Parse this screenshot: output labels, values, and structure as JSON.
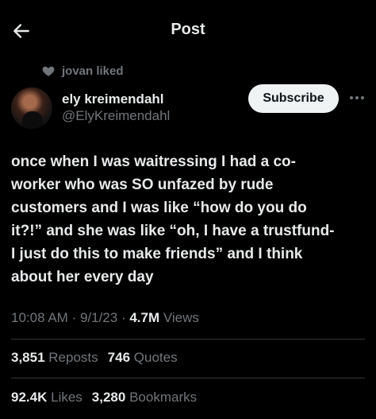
{
  "header": {
    "title": "Post"
  },
  "social_context": {
    "text": "jovan liked"
  },
  "author": {
    "name": "ely kreimendahl",
    "handle": "@ElyKreimendahl"
  },
  "actions": {
    "subscribe_label": "Subscribe"
  },
  "tweet": {
    "text": "once when I was waitressing I had a co-\nworker who was SO unfazed by rude\ncustomers and I was like “how do you do\nit?!” and she was like “oh, I have a trustfund-\nI just do this to make friends” and I think\nabout her every day",
    "time": "10:08 AM",
    "date": "9/1/23",
    "views_count": "4.7M",
    "views_label": "Views"
  },
  "stats": {
    "reposts_count": "3,851",
    "reposts_label": "Reposts",
    "quotes_count": "746",
    "quotes_label": "Quotes",
    "likes_count": "92.4K",
    "likes_label": "Likes",
    "bookmarks_count": "3,280",
    "bookmarks_label": "Bookmarks"
  },
  "icons": {
    "back": "arrow-left-icon",
    "heart": "heart-icon",
    "more": "more-horizontal-icon"
  },
  "colors": {
    "background": "#000000",
    "text": "#e7e9ea",
    "secondary": "#71767b",
    "button_bg": "#eff3f4",
    "divider": "#2f3336"
  }
}
